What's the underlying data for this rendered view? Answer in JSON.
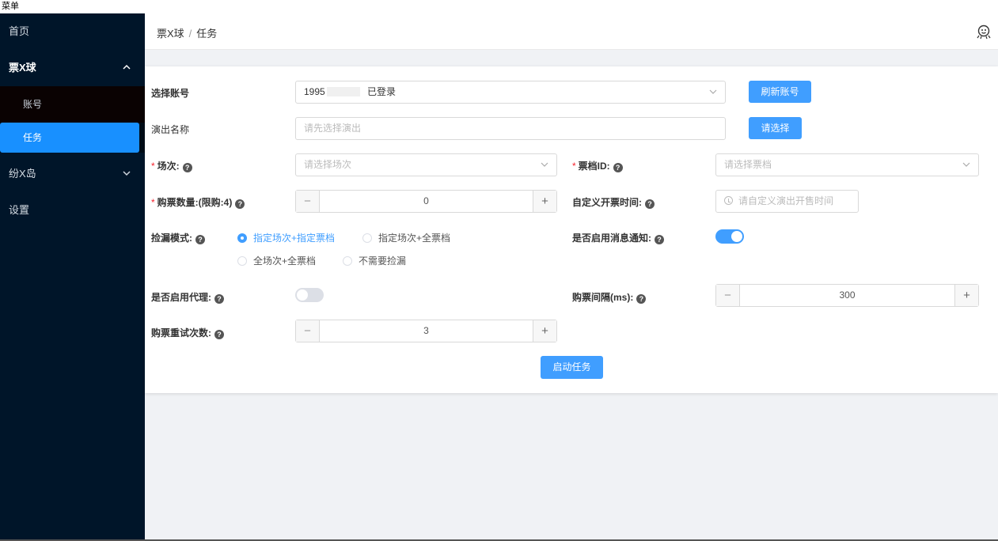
{
  "menubar": {
    "label": "菜单"
  },
  "sidebar": {
    "home": "首页",
    "group1": {
      "label": "票X球",
      "items": [
        "账号",
        "任务"
      ]
    },
    "group2": {
      "label": "纷X岛"
    },
    "settings": "设置"
  },
  "breadcrumb": {
    "root": "票X球",
    "sep": "/",
    "current": "任务"
  },
  "form": {
    "account": {
      "label": "选择账号",
      "value_prefix": "1995",
      "value_suffix": "已登录",
      "refresh_label": "刷新账号"
    },
    "show": {
      "label": "演出名称",
      "placeholder": "请先选择演出",
      "button_label": "请选择"
    },
    "session": {
      "required": "*",
      "label": "场次:",
      "placeholder": "请选择场次"
    },
    "ticket": {
      "required": "*",
      "label": "票档ID:",
      "placeholder": "请选择票档"
    },
    "quantity": {
      "required": "*",
      "label": "购票数量:(限购:4)",
      "value": "0",
      "minus": "−",
      "plus": "+"
    },
    "custom_time": {
      "label": "自定义开票时间:",
      "placeholder": "请自定义演出开售时间"
    },
    "mode": {
      "label": "捡漏模式:",
      "options": [
        "指定场次+指定票档",
        "指定场次+全票档",
        "全场次+全票档",
        "不需要捡漏"
      ],
      "selected": "指定场次+指定票档"
    },
    "notify": {
      "label": "是否启用消息通知:",
      "enabled": true
    },
    "proxy": {
      "label": "是否启用代理:",
      "enabled": false
    },
    "interval": {
      "label": "购票间隔(ms):",
      "value": "300",
      "minus": "−",
      "plus": "+"
    },
    "retry": {
      "label": "购票重试次数:",
      "value": "3",
      "minus": "−",
      "plus": "+"
    },
    "start_label": "启动任务"
  },
  "icons": {
    "help": "?",
    "caret_up": "^",
    "caret_down": "v",
    "select_arrow": "v"
  },
  "colors": {
    "primary": "#409eff",
    "sidebar": "#001529",
    "selected": "#1890ff",
    "required": "#f5222d"
  }
}
